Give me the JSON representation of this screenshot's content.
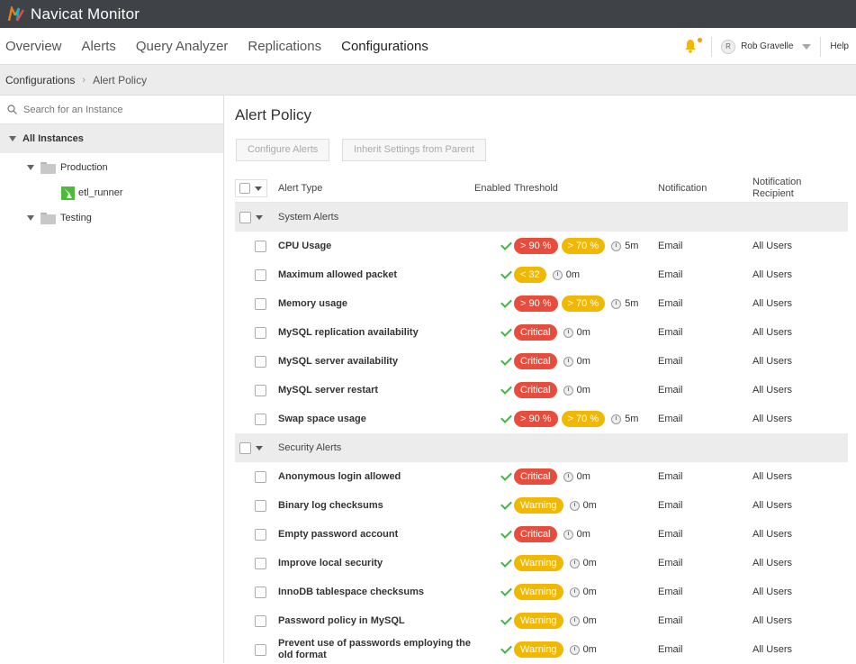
{
  "app": {
    "title": "Navicat Monitor"
  },
  "nav": {
    "tabs": [
      "Overview",
      "Alerts",
      "Query Analyzer",
      "Replications",
      "Configurations"
    ],
    "active": "Configurations",
    "user": {
      "initial": "R",
      "name": "Rob Gravelle"
    },
    "help": "Help"
  },
  "breadcrumb": [
    "Configurations",
    "Alert Policy"
  ],
  "sidebar": {
    "search_placeholder": "Search for an Instance",
    "root": "All Instances",
    "groups": [
      {
        "name": "Production",
        "instances": [
          "etl_runner"
        ]
      },
      {
        "name": "Testing",
        "instances": []
      }
    ]
  },
  "main": {
    "title": "Alert Policy",
    "buttons": {
      "configure": "Configure Alerts",
      "inherit": "Inherit Settings from Parent"
    },
    "columns": {
      "type": "Alert Type",
      "enabled": "Enabled",
      "threshold": "Threshold",
      "notification": "Notification",
      "recipient": "Notification Recipient"
    },
    "groups": [
      {
        "name": "System Alerts",
        "rows": [
          {
            "type": "CPU Usage",
            "badges": [
              {
                "text": "> 90 %",
                "color": "red"
              },
              {
                "text": "> 70 %",
                "color": "yellow"
              }
            ],
            "duration": "5m",
            "notification": "Email",
            "recipient": "All Users"
          },
          {
            "type": "Maximum allowed packet",
            "badges": [
              {
                "text": "< 32",
                "color": "yellow"
              }
            ],
            "duration": "0m",
            "notification": "Email",
            "recipient": "All Users"
          },
          {
            "type": "Memory usage",
            "badges": [
              {
                "text": "> 90 %",
                "color": "red"
              },
              {
                "text": "> 70 %",
                "color": "yellow"
              }
            ],
            "duration": "5m",
            "notification": "Email",
            "recipient": "All Users"
          },
          {
            "type": "MySQL replication availability",
            "badges": [
              {
                "text": "Critical",
                "color": "red"
              }
            ],
            "duration": "0m",
            "notification": "Email",
            "recipient": "All Users"
          },
          {
            "type": "MySQL server availability",
            "badges": [
              {
                "text": "Critical",
                "color": "red"
              }
            ],
            "duration": "0m",
            "notification": "Email",
            "recipient": "All Users"
          },
          {
            "type": "MySQL server restart",
            "badges": [
              {
                "text": "Critical",
                "color": "red"
              }
            ],
            "duration": "0m",
            "notification": "Email",
            "recipient": "All Users"
          },
          {
            "type": "Swap space usage",
            "badges": [
              {
                "text": "> 90 %",
                "color": "red"
              },
              {
                "text": "> 70 %",
                "color": "yellow"
              }
            ],
            "duration": "5m",
            "notification": "Email",
            "recipient": "All Users"
          }
        ]
      },
      {
        "name": "Security Alerts",
        "rows": [
          {
            "type": "Anonymous login allowed",
            "badges": [
              {
                "text": "Critical",
                "color": "red"
              }
            ],
            "duration": "0m",
            "notification": "Email",
            "recipient": "All Users"
          },
          {
            "type": "Binary log checksums",
            "badges": [
              {
                "text": "Warning",
                "color": "yellow"
              }
            ],
            "duration": "0m",
            "notification": "Email",
            "recipient": "All Users"
          },
          {
            "type": "Empty password account",
            "badges": [
              {
                "text": "Critical",
                "color": "red"
              }
            ],
            "duration": "0m",
            "notification": "Email",
            "recipient": "All Users"
          },
          {
            "type": "Improve local security",
            "badges": [
              {
                "text": "Warning",
                "color": "yellow"
              }
            ],
            "duration": "0m",
            "notification": "Email",
            "recipient": "All Users"
          },
          {
            "type": "InnoDB tablespace checksums",
            "badges": [
              {
                "text": "Warning",
                "color": "yellow"
              }
            ],
            "duration": "0m",
            "notification": "Email",
            "recipient": "All Users"
          },
          {
            "type": "Password policy in MySQL",
            "badges": [
              {
                "text": "Warning",
                "color": "yellow"
              }
            ],
            "duration": "0m",
            "notification": "Email",
            "recipient": "All Users"
          },
          {
            "type": "Prevent use of passwords employing the old format",
            "badges": [
              {
                "text": "Warning",
                "color": "yellow"
              }
            ],
            "duration": "0m",
            "notification": "Email",
            "recipient": "All Users"
          }
        ]
      }
    ]
  },
  "colors": {
    "titlebar": "#3f4347",
    "critical": "#e74c3c",
    "warning": "#f0b800",
    "enabled_check": "#45b649",
    "instance_icon": "#4cba3a"
  }
}
